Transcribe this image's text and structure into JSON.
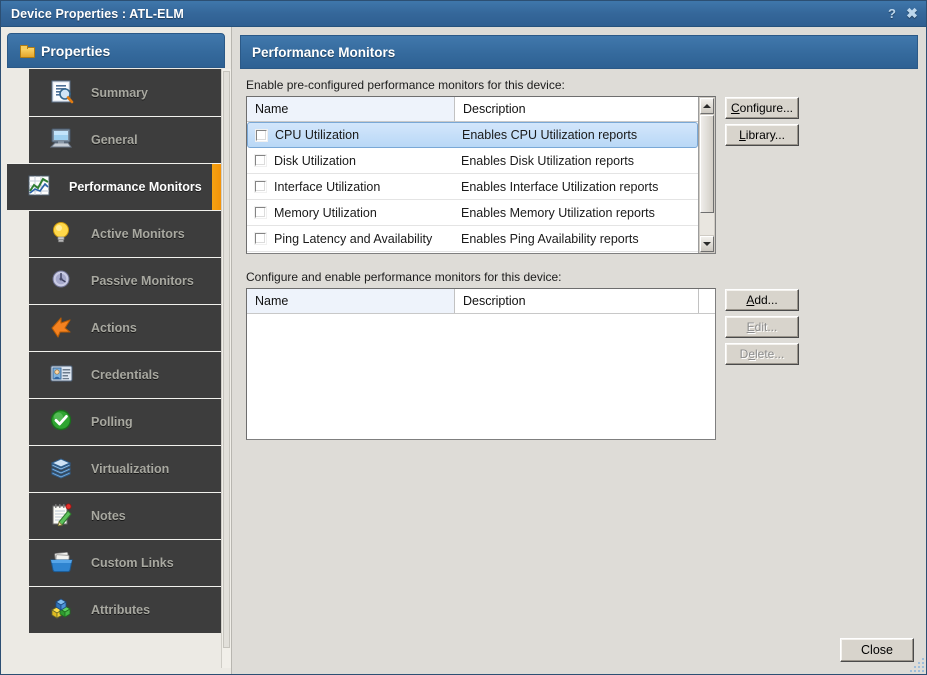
{
  "window": {
    "title": "Device Properties : ATL-ELM",
    "help_icon": "question-mark-icon",
    "close_icon": "close-icon",
    "accent_color": "#f5a212",
    "titlebar_color": "#35679a"
  },
  "sidebar": {
    "header": {
      "label": "Properties",
      "icon": "folder-icon"
    },
    "items": [
      {
        "label": "Summary",
        "icon": "summary-report-icon",
        "active": false
      },
      {
        "label": "General",
        "icon": "monitor-computer-icon",
        "active": false
      },
      {
        "label": "Performance Monitors",
        "icon": "chart-graph-icon",
        "active": true
      },
      {
        "label": "Active Monitors",
        "icon": "lightbulb-icon",
        "active": false
      },
      {
        "label": "Passive Monitors",
        "icon": "satellite-dish-icon",
        "active": false
      },
      {
        "label": "Actions",
        "icon": "orange-arrow-icon",
        "active": false
      },
      {
        "label": "Credentials",
        "icon": "id-card-icon",
        "active": false
      },
      {
        "label": "Polling",
        "icon": "green-check-circle-icon",
        "active": false
      },
      {
        "label": "Virtualization",
        "icon": "stacked-disks-icon",
        "active": false
      },
      {
        "label": "Notes",
        "icon": "notepad-pencil-icon",
        "active": false
      },
      {
        "label": "Custom Links",
        "icon": "card-file-box-icon",
        "active": false
      },
      {
        "label": "Attributes",
        "icon": "colored-cubes-icon",
        "active": false
      }
    ]
  },
  "main": {
    "header": "Performance Monitors",
    "preconfigured": {
      "label": "Enable pre-configured performance monitors for this device:",
      "columns": [
        "Name",
        "Description"
      ],
      "sorted_column": "Name",
      "rows": [
        {
          "checked": false,
          "selected": true,
          "name": "CPU Utilization",
          "description": "Enables CPU Utilization reports"
        },
        {
          "checked": false,
          "selected": false,
          "name": "Disk Utilization",
          "description": "Enables Disk Utilization reports"
        },
        {
          "checked": false,
          "selected": false,
          "name": "Interface Utilization",
          "description": "Enables Interface Utilization reports"
        },
        {
          "checked": false,
          "selected": false,
          "name": "Memory Utilization",
          "description": "Enables Memory Utilization reports"
        },
        {
          "checked": false,
          "selected": false,
          "name": "Ping Latency and Availability",
          "description": "Enables Ping Availability reports"
        }
      ],
      "buttons": [
        {
          "label": "Configure...",
          "mnemonic": "C",
          "disabled": false
        },
        {
          "label": "Library...",
          "mnemonic": "L",
          "disabled": false
        }
      ]
    },
    "configurable": {
      "label": "Configure and enable performance monitors for this device:",
      "columns": [
        "Name",
        "Description"
      ],
      "sorted_column": "Name",
      "rows": [],
      "buttons": [
        {
          "label": "Add...",
          "mnemonic": "A",
          "disabled": false
        },
        {
          "label": "Edit...",
          "mnemonic": "E",
          "disabled": true
        },
        {
          "label": "Delete...",
          "mnemonic": "e",
          "disabled": true
        }
      ]
    },
    "close_button": "Close"
  }
}
